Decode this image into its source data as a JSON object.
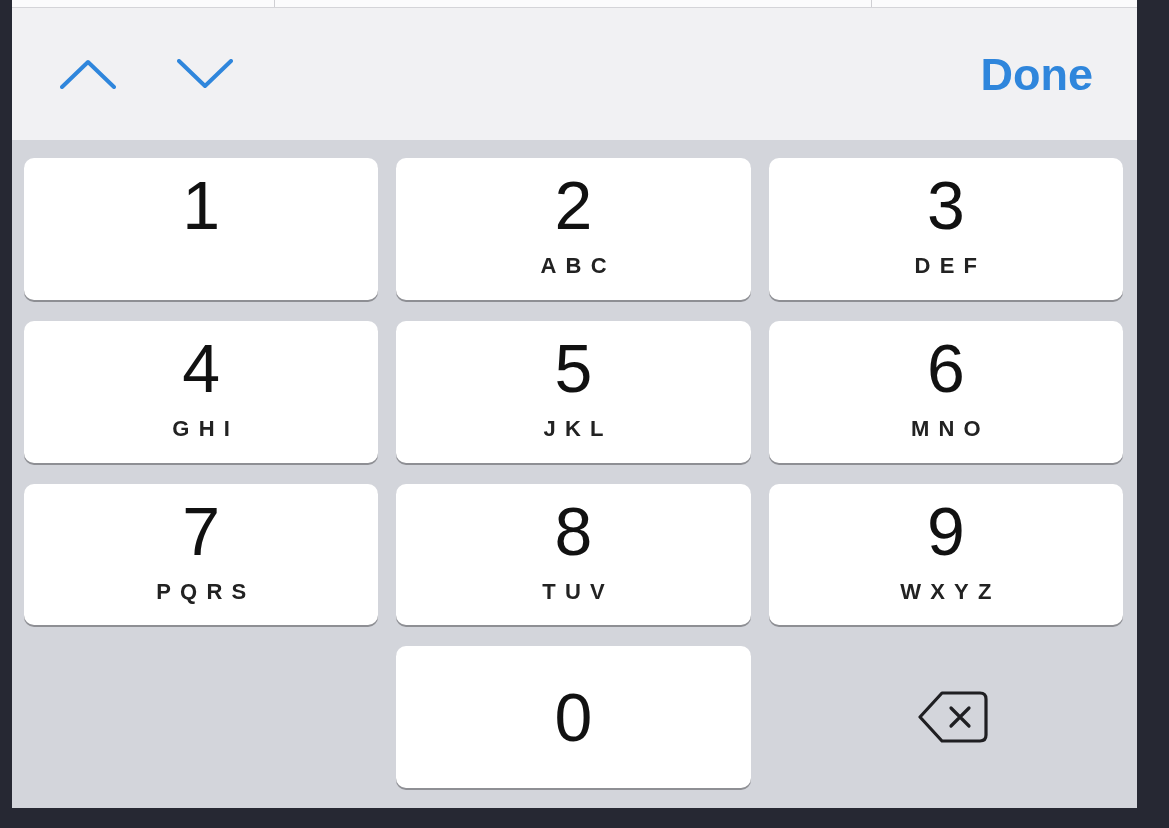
{
  "accessory_bar": {
    "buttons": [
      {
        "kind": "previous"
      },
      {
        "kind": "next"
      }
    ],
    "done": "Done"
  },
  "keypad": {
    "keys": [
      {
        "kind": "digit",
        "digit": "1"
      },
      {
        "kind": "digit",
        "digit": "2",
        "letters": "ABC"
      },
      {
        "kind": "digit",
        "digit": "3",
        "letters": "DEF"
      },
      {
        "kind": "digit",
        "digit": "4",
        "letters": "GHI"
      },
      {
        "kind": "digit",
        "digit": "5",
        "letters": "JKL"
      },
      {
        "kind": "digit",
        "digit": "6",
        "letters": "MNO"
      },
      {
        "kind": "digit",
        "digit": "7",
        "letters": "PQRS"
      },
      {
        "kind": "digit",
        "digit": "8",
        "letters": "TUV"
      },
      {
        "kind": "digit",
        "digit": "9",
        "letters": "WXYZ"
      },
      {
        "kind": "digit",
        "digit": "0"
      },
      {
        "kind": "delete"
      }
    ]
  }
}
